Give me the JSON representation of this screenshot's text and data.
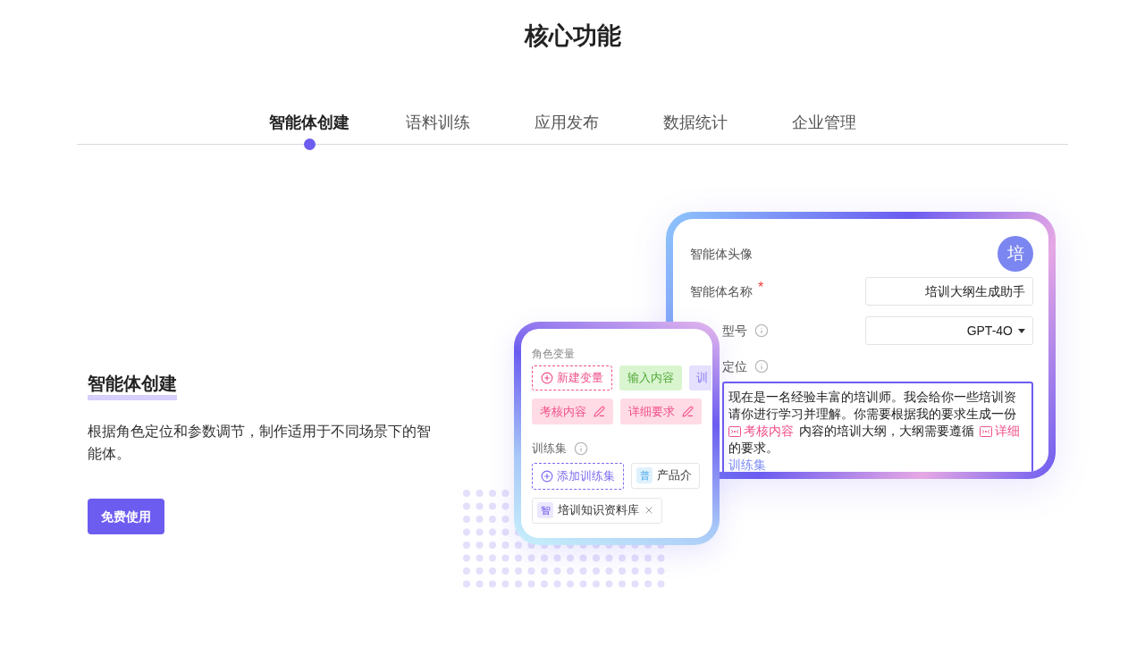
{
  "title": "核心功能",
  "tabs": [
    {
      "label": "智能体创建",
      "selected": true
    },
    {
      "label": "语料训练",
      "selected": false
    },
    {
      "label": "应用发布",
      "selected": false
    },
    {
      "label": "数据统计",
      "selected": false
    },
    {
      "label": "企业管理",
      "selected": false
    }
  ],
  "feature": {
    "heading": "智能体创建",
    "description": "根据角色定位和参数调节，制作适用于不同场景下的智能体。",
    "button": "免费使用"
  },
  "agent_form": {
    "avatar_label": "智能体头像",
    "avatar_text": "培",
    "name_label": "智能体名称",
    "required_mark": "*",
    "name_value": "培训大纲生成助手",
    "model_label": "型号",
    "model_value": "GPT-4O",
    "role_label": "定位",
    "prompt_lines": [
      [
        {
          "kind": "text",
          "text": "现在是一名经验丰富的培训师。我会给你一些培训资"
        }
      ],
      [
        {
          "kind": "text",
          "text": "请你进行学习并理解。你需要根据我的要求生成一份"
        }
      ],
      [
        {
          "kind": "variable",
          "text": "考核内容"
        },
        {
          "kind": "text",
          "text": "内容的培训大纲，大纲需要遵循"
        },
        {
          "kind": "variable",
          "text": "详细"
        }
      ],
      [
        {
          "kind": "text",
          "text": "的要求。"
        }
      ],
      [
        {
          "kind": "link",
          "text": "训练集"
        }
      ]
    ]
  },
  "variable_card": {
    "variables_label": "角色变量",
    "variables": [
      {
        "kind": "add",
        "label": "新建变量"
      },
      {
        "kind": "input",
        "label": "输入内容"
      },
      {
        "kind": "training",
        "label": "训"
      },
      {
        "kind": "editable",
        "label": "考核内容"
      },
      {
        "kind": "editable",
        "label": "详细要求"
      }
    ],
    "training_label": "训练集",
    "training_sets": [
      {
        "kind": "add",
        "label": "添加训练集"
      },
      {
        "kind": "set",
        "badge": "普",
        "label": "产品介",
        "color": "#dff1fd",
        "removable": false
      },
      {
        "kind": "set",
        "badge": "智",
        "label": "培训知识资料库",
        "color": "#ebe7fd",
        "removable": true
      }
    ]
  }
}
